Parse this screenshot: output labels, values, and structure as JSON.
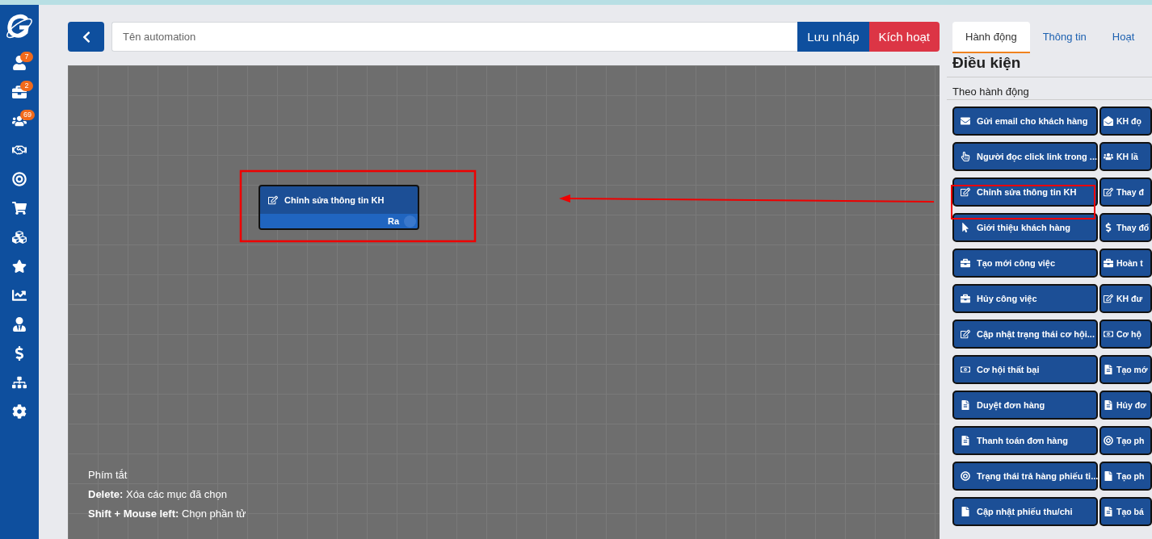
{
  "sidebar": {
    "badges": [
      "7",
      "2",
      "69"
    ]
  },
  "toolbar": {
    "name_placeholder": "Tên automation",
    "buttons": [
      {
        "label": "Lưu nháp",
        "kind": "draft"
      },
      {
        "label": "Kích hoạt",
        "kind": "activate"
      }
    ]
  },
  "canvas": {
    "node": {
      "title": "Chỉnh sửa thông tin KH",
      "output": "Ra"
    },
    "shortcuts": {
      "title": "Phím tắt",
      "lines": [
        "**Delete:** Xóa các mục đã chọn",
        "**Shift + Mouse left:** Chọn phần tử"
      ]
    }
  },
  "panel": {
    "tabs": [
      {
        "label": "Hành động",
        "selected": true
      },
      {
        "label": "Thông tin",
        "selected": false
      },
      {
        "label": "Hoạt",
        "selected": false
      }
    ],
    "heading": "Điều kiện",
    "section": "Theo hành động",
    "conditions": [
      {
        "label": "Gửi email cho khách hàng"
      },
      {
        "label": "KH đọ"
      },
      {
        "label": "Người đọc click link trong ..."
      },
      {
        "label": "KH lầ"
      },
      {
        "label": "Chỉnh sửa thông tin KH"
      },
      {
        "label": "Thay đ"
      },
      {
        "label": "Giới thiệu khách hàng"
      },
      {
        "label": "Thay đổ"
      },
      {
        "label": "Tạo mới công việc"
      },
      {
        "label": "Hoàn t"
      },
      {
        "label": "Hủy công việc"
      },
      {
        "label": "KH đư"
      },
      {
        "label": "Cập nhật trạng thái cơ hội..."
      },
      {
        "label": "Cơ hộ"
      },
      {
        "label": "Cơ hội thất bại"
      },
      {
        "label": "Tạo mớ"
      },
      {
        "label": "Duyệt đơn hàng"
      },
      {
        "label": "Hủy đơ"
      },
      {
        "label": "Thanh toán đơn hàng"
      },
      {
        "label": "Tạo ph"
      },
      {
        "label": "Trạng thái trả hàng phiếu ti..."
      },
      {
        "label": "Tạo ph"
      },
      {
        "label": "Cập nhật phiếu thu/chi"
      },
      {
        "label": "Tạo bá"
      }
    ]
  }
}
